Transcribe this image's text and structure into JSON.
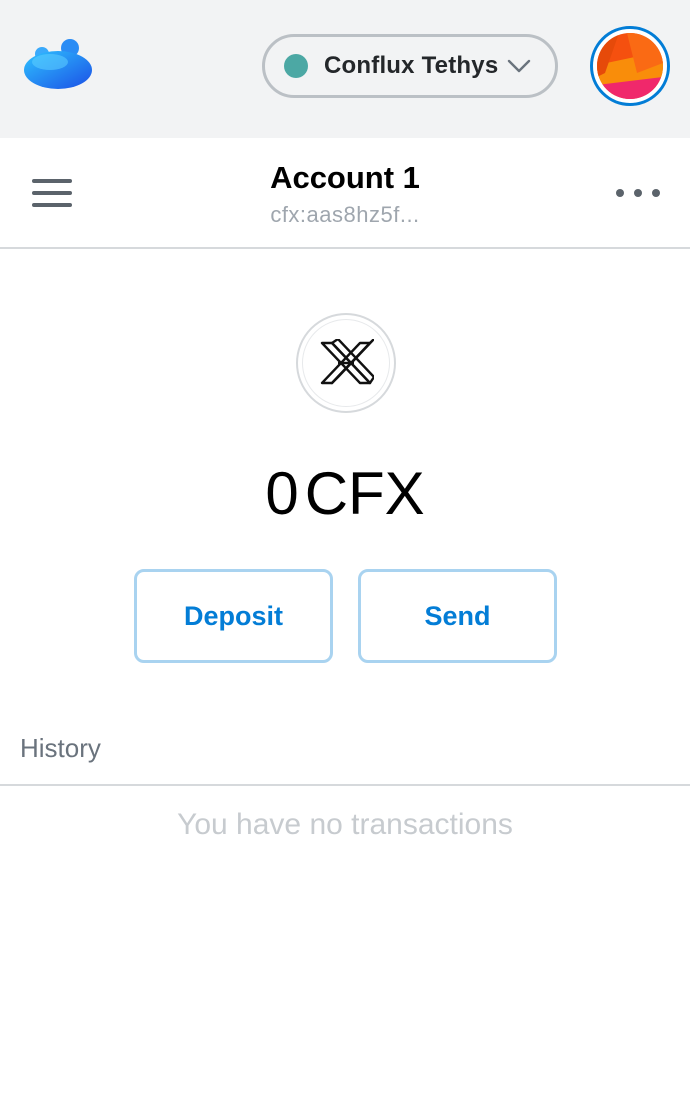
{
  "header": {
    "logo_icon": "conflux-portal-logo-icon",
    "network": {
      "name": "Conflux Tethys",
      "status_color": "#4ca8a4",
      "dropdown_icon": "chevron-down-icon"
    },
    "avatar_icon": "account-identicon"
  },
  "account": {
    "menu_icon": "hamburger-menu-icon",
    "name": "Account 1",
    "address": "cfx:aas8hz5f...",
    "options_icon": "more-options-icon"
  },
  "balance": {
    "token_icon": "conflux-cfx-token-icon",
    "amount": "0",
    "symbol": "CFX"
  },
  "actions": {
    "deposit_label": "Deposit",
    "send_label": "Send"
  },
  "history": {
    "title": "History",
    "empty_message": "You have no transactions"
  },
  "colors": {
    "accent": "#037dd6",
    "button_border": "#a9d3f0",
    "header_bg": "#f2f3f4"
  }
}
